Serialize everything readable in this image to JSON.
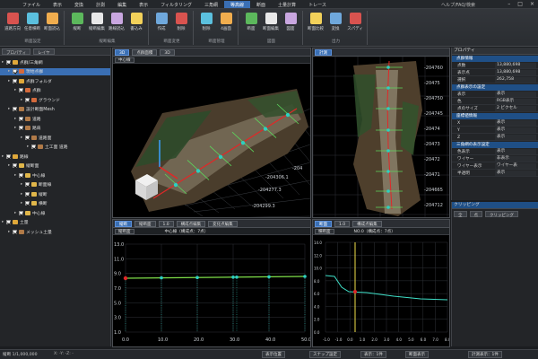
{
  "menu": {
    "items": [
      "ファイル",
      "表示",
      "変換",
      "計測",
      "編集",
      "表示",
      "フィルタリング",
      "三角網",
      "等高線",
      "断面",
      "土量計算",
      "トレース"
    ],
    "active_index": 8,
    "right_label": "ヘルプ/FAQ/検索"
  },
  "ribbon": {
    "groups": [
      {
        "label": "断面設定",
        "buttons": [
          "道路方向",
          "任意横断",
          "断面読込"
        ]
      },
      {
        "label": "縦断編集",
        "buttons": [
          "縦断",
          "縦断編集",
          "路線読込",
          "書込み"
        ]
      },
      {
        "label": "断面変更",
        "buttons": [
          "作成",
          "削除"
        ]
      },
      {
        "label": "断面管理",
        "buttons": [
          "削除",
          "4画面"
        ]
      },
      {
        "label": "図面",
        "buttons": [
          "断面",
          "断面編集",
          "図面"
        ]
      },
      {
        "label": "出力",
        "buttons": [
          "断面比較",
          "変換",
          "スパディ"
        ]
      }
    ]
  },
  "tree": {
    "tabs": [
      "プロパティ",
      "レイヤ"
    ],
    "rows": [
      {
        "label": "点群/三角網",
        "level": 0,
        "icon": "folder"
      },
      {
        "label": "現地点群",
        "level": 1,
        "icon": "cloud",
        "selected": true
      },
      {
        "label": "点群フォルダ",
        "level": 1,
        "icon": "folder"
      },
      {
        "label": "点群",
        "level": 2,
        "icon": "cloud"
      },
      {
        "label": "グラウンド",
        "level": 3,
        "icon": "cloud"
      },
      {
        "label": "設計断面Mesh",
        "level": 1,
        "icon": "mesh"
      },
      {
        "label": "道路",
        "level": 2,
        "icon": "mesh"
      },
      {
        "label": "路肩",
        "level": 2,
        "icon": "mesh"
      },
      {
        "label": "道路面",
        "level": 3,
        "icon": "mesh"
      },
      {
        "label": "土工面 道路",
        "level": 4,
        "icon": "mesh"
      },
      {
        "label": "路線",
        "level": 0,
        "icon": "folder"
      },
      {
        "label": "縦断面",
        "level": 1,
        "icon": "line"
      },
      {
        "label": "中心線",
        "level": 2,
        "icon": "line"
      },
      {
        "label": "断面線",
        "level": 3,
        "icon": "line"
      },
      {
        "label": "縦断",
        "level": 3,
        "icon": "line"
      },
      {
        "label": "横断",
        "level": 3,
        "icon": "line"
      },
      {
        "label": "中心線",
        "level": 2,
        "icon": "line"
      },
      {
        "label": "土量",
        "level": 0,
        "icon": "folder"
      },
      {
        "label": "メッシュ土量",
        "level": 1,
        "icon": "mesh"
      }
    ]
  },
  "viewport3d": {
    "tabs": [
      "3D",
      "点群面積",
      "3D"
    ],
    "dropdown": "中心線",
    "coords": [
      "-204277.3",
      "-204306.1",
      "-204299.3",
      "-204286.2",
      "-204",
      "204299.3",
      "-204"
    ]
  },
  "viewport_plan": {
    "title": "計測",
    "coords": [
      "-204760",
      "-20475",
      "-204750",
      "-204745",
      "-20474",
      "-20473",
      "-20472",
      "-20471",
      "-204665",
      "-204712"
    ]
  },
  "profile_long": {
    "tabs": [
      "縦断",
      "縦断面",
      "1.0",
      "構成点編集",
      "変化点編集"
    ],
    "dropdown": "縦断面",
    "caption": "中心線（構成点：7点）",
    "x_ticks": [
      "0.0",
      "10.0",
      "20.0",
      "30.0",
      "40.0",
      "50.0"
    ],
    "y_ticks": [
      "13.0",
      "11.0",
      "9.0",
      "7.0",
      "5.0",
      "3.0",
      "1.0"
    ]
  },
  "profile_cross": {
    "tabs": [
      "断面",
      "1.0",
      "構成点編集"
    ],
    "dropdown": "横断面",
    "caption": "NO.0（構成点：7点）",
    "x_ticks": [
      "-1.0",
      "-1.0",
      "0.0",
      "1.0",
      "2.0",
      "3.0",
      "4.0",
      "5.0",
      "6.0",
      "7.0",
      "8.0"
    ],
    "y_ticks": [
      "14.0",
      "12.0",
      "10.0",
      "8.0",
      "6.0",
      "4.0",
      "2.0",
      "0.0"
    ]
  },
  "properties": {
    "header": "プロパティ",
    "sections": [
      {
        "title": "点群情報",
        "rows": [
          [
            "点数",
            "13,880,698"
          ],
          [
            "表示点",
            "13,880,698"
          ],
          [
            "選択",
            "262,758"
          ]
        ]
      },
      {
        "title": "点群表示の設定",
        "rows": [
          [
            "表示",
            "表示"
          ],
          [
            "色",
            "RGB表示"
          ],
          [
            "点のサイズ",
            "2 ピクセル"
          ]
        ]
      },
      {
        "title": "座標値情報",
        "rows": [
          [
            "X",
            "表示"
          ],
          [
            "Y",
            "表示"
          ],
          [
            "Z",
            "表示"
          ]
        ]
      },
      {
        "title": "三角網の表示設定",
        "rows": [
          [
            "色表示",
            "表示"
          ],
          [
            "ワイヤー",
            "非表示"
          ],
          [
            "ワイヤー表示",
            "ワイヤー表"
          ],
          [
            "半透明",
            "表示"
          ]
        ]
      }
    ]
  },
  "clipping": {
    "header": "クリッピング",
    "buttons": [
      "全",
      "点",
      "クリッピング"
    ]
  },
  "statusbar": {
    "left": "縦断 1/1,000,000",
    "coords": "X: -Y: -Z: -",
    "buttons": [
      "表示位置",
      "スナップ設定",
      "表示：1件",
      "断面表示",
      "計測表示：1件"
    ]
  }
}
